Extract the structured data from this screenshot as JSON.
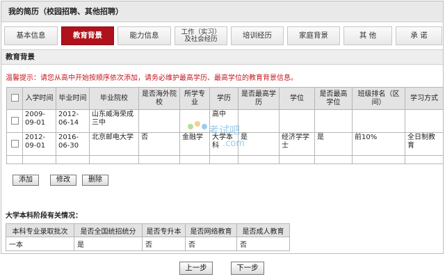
{
  "page_title": "我的简历（校园招聘、其他招聘）",
  "tabs": [
    {
      "label": "基本信息",
      "active": false
    },
    {
      "label": "教育背景",
      "active": true
    },
    {
      "label": "能力信息",
      "active": false
    },
    {
      "label": "工作（实习）\n及社会经历",
      "active": false
    },
    {
      "label": "培训经历",
      "active": false
    },
    {
      "label": "家庭背景",
      "active": false
    },
    {
      "label": "其 他",
      "active": false
    },
    {
      "label": "承 诺",
      "active": false
    }
  ],
  "section_title": "教育背景",
  "tip": "温馨提示：请您从高中开始按顺序依次添加，请务必维护最高学历、最高学位的教育背景信息。",
  "education_table": {
    "headers": [
      "入学时间",
      "毕业时间",
      "毕业院校",
      "是否海外院校",
      "所学专业",
      "学历",
      "是否最高学历",
      "学位",
      "是否最高学位",
      "班级排名（区间）",
      "学习方式"
    ],
    "rows": [
      [
        "2009-09-01",
        "2012-06-14",
        "山东威海荣成三中",
        "",
        "",
        "高中",
        "",
        "",
        "",
        "",
        ""
      ],
      [
        "2012-09-01",
        "2016-06-30",
        "北京邮电大学",
        "否",
        "金融学",
        "大学本科",
        "是",
        "经济学学士",
        "是",
        "前10%",
        "全日制教育"
      ]
    ]
  },
  "buttons": {
    "add": "添加",
    "edit": "修改",
    "delete": "删除"
  },
  "undergrad_heading": "大学本科阶段有关情况：",
  "undergrad_table": {
    "headers": [
      "本科专业录取批次",
      "是否全国统招统分",
      "是否专升本",
      "是否网络教育",
      "是否成人教育"
    ],
    "rows": [
      [
        "一本",
        "是",
        "否",
        "否",
        "否"
      ]
    ]
  },
  "nav": {
    "prev": "上一步",
    "next": "下一步"
  },
  "watermark": {
    "text": "考试吧",
    "sub": ".com",
    "color": "#4aa3e0"
  },
  "colors": {
    "accent": "#b0121b",
    "tip": "#c4161c",
    "header_bg": "#e3e3e3"
  }
}
